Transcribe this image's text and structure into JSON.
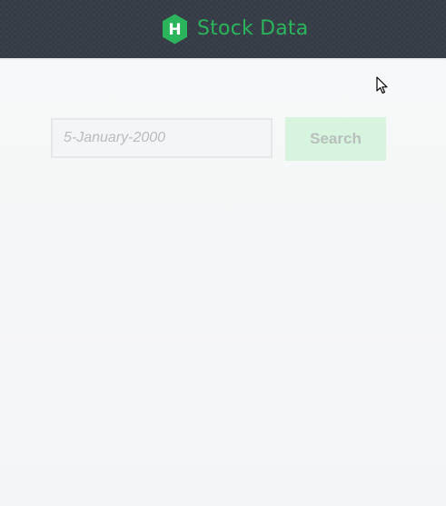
{
  "header": {
    "title": "Stock Data",
    "logo_letter": "H",
    "logo_icon": "hexagon-logo-icon",
    "accent": "#2bb45b"
  },
  "search": {
    "date_placeholder": "5-January-2000",
    "date_value": "",
    "button_label": "Search",
    "button_color": "#d7f4de"
  },
  "cursor": {
    "icon": "mouse-pointer-icon"
  }
}
